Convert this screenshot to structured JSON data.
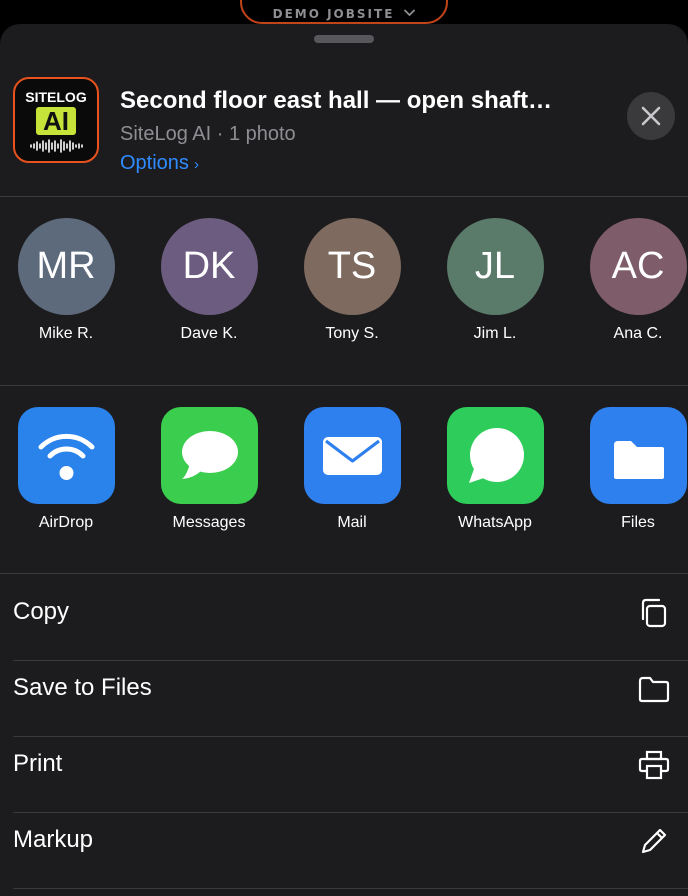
{
  "background_app": {
    "workspace_label": "DEMO JOBSITE"
  },
  "share_sheet": {
    "app_icon": {
      "brand_top": "SITELOG",
      "brand_ai": "AI"
    },
    "title": "Second floor east hall — open shaft…",
    "subtitle": "SiteLog AI · 1 photo",
    "options_label": "Options",
    "options_arrow": "›"
  },
  "people": [
    {
      "initials": "MR",
      "name": "Mike R.",
      "color": "#5d6a7c"
    },
    {
      "initials": "DK",
      "name": "Dave K.",
      "color": "#6c5c80"
    },
    {
      "initials": "TS",
      "name": "Tony S.",
      "color": "#7e6a5e"
    },
    {
      "initials": "JL",
      "name": "Jim L.",
      "color": "#5a7a6a"
    },
    {
      "initials": "AC",
      "name": "Ana C.",
      "color": "#7e5c6a"
    }
  ],
  "apps": [
    {
      "name": "AirDrop",
      "icon": "airdrop-icon",
      "color": "#2a82eb"
    },
    {
      "name": "Messages",
      "icon": "messages-icon",
      "color": "#3acd4e"
    },
    {
      "name": "Mail",
      "icon": "mail-icon",
      "color": "#2f80ef"
    },
    {
      "name": "WhatsApp",
      "icon": "whatsapp-icon",
      "color": "#2ecc5b"
    },
    {
      "name": "Files",
      "icon": "folder-icon",
      "color": "#2f80ef"
    }
  ],
  "actions": [
    {
      "label": "Copy",
      "icon": "copy-icon"
    },
    {
      "label": "Save to Files",
      "icon": "folder-outline-icon"
    },
    {
      "label": "Print",
      "icon": "printer-icon"
    },
    {
      "label": "Markup",
      "icon": "pencil-icon"
    }
  ],
  "colors": {
    "sheet_bg": "#1c1c1e",
    "accent_link": "#2f8cff",
    "brand_orange": "#e8521c",
    "brand_lime": "#c6e33a"
  }
}
